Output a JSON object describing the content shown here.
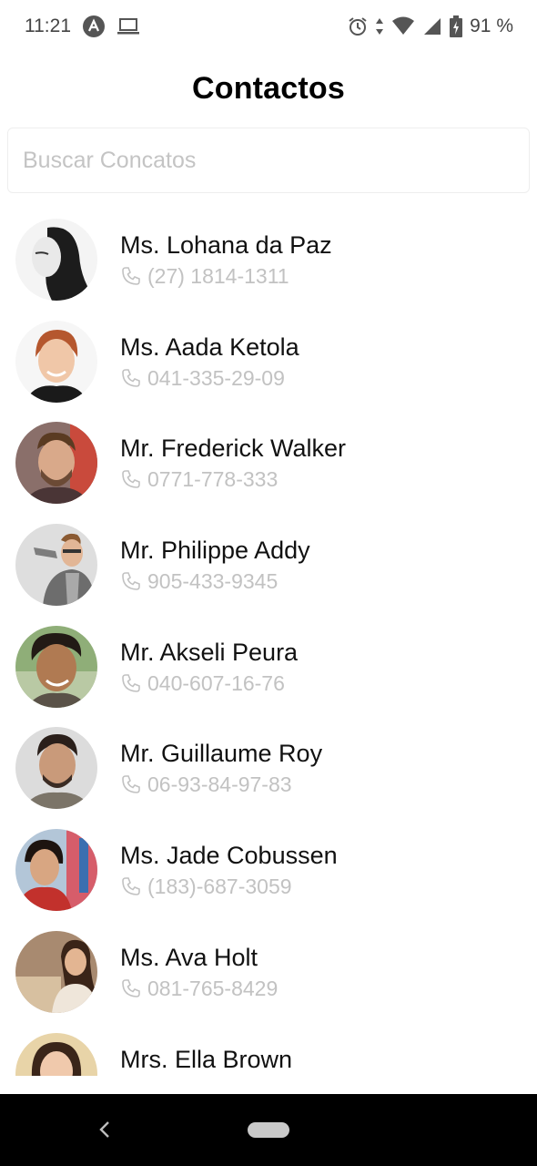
{
  "status_bar": {
    "time": "11:21",
    "battery": "91 %",
    "icons": [
      "app-notification-icon",
      "laptop-icon",
      "alarm-icon",
      "data-arrows-icon",
      "wifi-icon",
      "signal-icon",
      "battery-charging-icon"
    ]
  },
  "header": {
    "title": "Contactos"
  },
  "search": {
    "placeholder": "Buscar Concatos",
    "value": ""
  },
  "contacts": [
    {
      "name": "Ms. Lohana da Paz",
      "phone": "(27) 1814-1311"
    },
    {
      "name": "Ms. Aada Ketola",
      "phone": "041-335-29-09"
    },
    {
      "name": "Mr. Frederick Walker",
      "phone": "0771-778-333"
    },
    {
      "name": "Mr. Philippe Addy",
      "phone": "905-433-9345"
    },
    {
      "name": "Mr. Akseli Peura",
      "phone": "040-607-16-76"
    },
    {
      "name": "Mr. Guillaume Roy",
      "phone": "06-93-84-97-83"
    },
    {
      "name": "Ms. Jade Cobussen",
      "phone": "(183)-687-3059"
    },
    {
      "name": "Ms. Ava Holt",
      "phone": "081-765-8429"
    },
    {
      "name": "Mrs. Ella Brown",
      "phone": ""
    }
  ],
  "colors": {
    "name_text": "#111111",
    "phone_text": "#c2c2c2",
    "placeholder": "#c4c4c4",
    "nav_bar": "#000000"
  },
  "nav": {
    "icons": [
      "back-icon",
      "home-pill"
    ]
  }
}
